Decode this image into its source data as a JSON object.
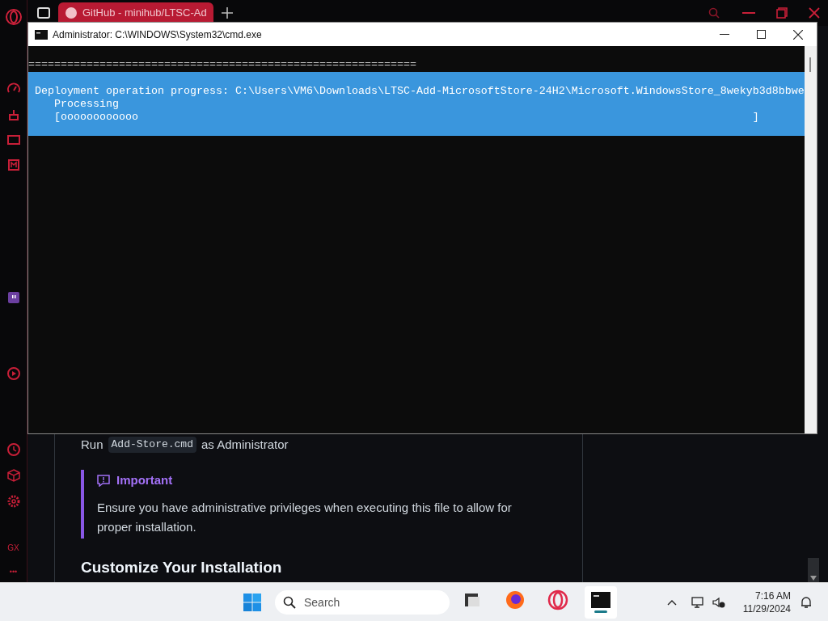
{
  "browser": {
    "tab_title": "GitHub - minihub/LTSC-Ad",
    "sidebar_badge": "GX",
    "sidebar_more": "•••"
  },
  "cmd_window": {
    "title": "Administrator: C:\\WINDOWS\\System32\\cmd.exe",
    "separator": "============================================================",
    "progress_lines": [
      "Deployment operation progress: C:\\Users\\VM6\\Downloads\\LTSC-Add-MicrosoftStore-24H2\\Microsoft.WindowsStore_8wekyb3d8bbwe",
      "   Processing",
      "   [oooooooooooo                                                                                               ]"
    ]
  },
  "page": {
    "run_prefix": "Run",
    "run_code": "Add-Store.cmd",
    "run_suffix": "as Administrator",
    "callout": {
      "title": "Important",
      "body": "Ensure you have administrative privileges when executing this file to allow for proper installation."
    },
    "heading": "Customize Your Installation"
  },
  "taskbar": {
    "search_placeholder": "Search",
    "apps": [
      {
        "kind": "files",
        "selected": false
      },
      {
        "kind": "firefox",
        "selected": false
      },
      {
        "kind": "opera",
        "selected": false
      },
      {
        "kind": "terminal",
        "selected": true
      }
    ],
    "time": "7:16 AM",
    "date": "11/29/2024"
  }
}
